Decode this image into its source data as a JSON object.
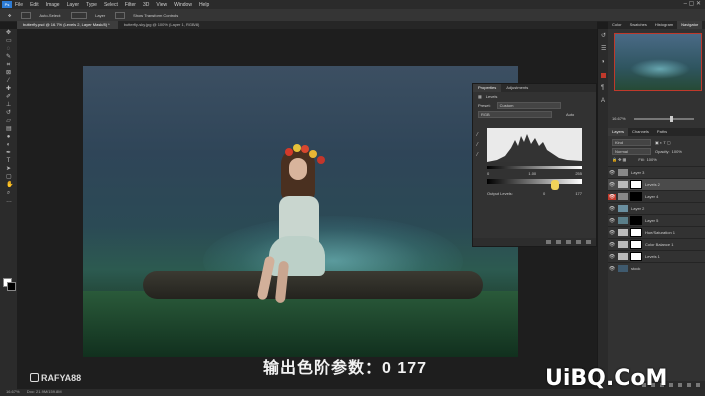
{
  "menubar": {
    "logo": "Ps",
    "items": [
      "File",
      "Edit",
      "Image",
      "Layer",
      "Type",
      "Select",
      "Filter",
      "3D",
      "View",
      "Window",
      "Help"
    ]
  },
  "options": {
    "auto_select": "Auto-Select:",
    "layer": "Layer",
    "show_transform": "Show Transform Controls"
  },
  "tabs": [
    {
      "label": "butterfly.psd @ 16.7% (Levels 2, Layer Mask/8) *",
      "active": true
    },
    {
      "label": "butterfly-sky.jpg @ 100% (Layer 1, RGB/8)",
      "active": false
    }
  ],
  "properties": {
    "tab1": "Properties",
    "tab2": "Adjustments",
    "levels_label": "Levels",
    "preset_label": "Preset:",
    "preset_value": "Custom",
    "channel_value": "RGB",
    "auto_label": "Auto",
    "input_low": "0",
    "input_mid": "1.00",
    "input_high": "255",
    "output_label": "Output Levels:",
    "output_low": "0",
    "output_high": "177"
  },
  "subtitle": "输出色阶参数：0 177",
  "watermark_left": "RAFYA88",
  "watermark_right": "UiBQ.CoM",
  "status": {
    "zoom": "16.67%",
    "doc": "Doc: 21.9M/159.8M"
  },
  "right_panel": {
    "tabs": [
      "Color",
      "Swatches",
      "Histogram",
      "Navigator"
    ],
    "active_tab": "Navigator",
    "zoom": "16.67%"
  },
  "layers_panel": {
    "tabs": [
      "Layers",
      "Channels",
      "Paths"
    ],
    "kind": "Kind",
    "blend_mode": "Normal",
    "opacity_label": "Opacity:",
    "opacity_value": "100%",
    "fill_label": "Fill:",
    "fill_value": "100%",
    "layers": [
      {
        "name": "Layer 3",
        "mask": false,
        "selected": false,
        "eye_red": false
      },
      {
        "name": "Levels 2",
        "mask": true,
        "selected": true,
        "eye_red": false
      },
      {
        "name": "Layer 4",
        "mask": true,
        "selected": false,
        "eye_red": true
      },
      {
        "name": "Layer 2",
        "mask": false,
        "selected": false,
        "eye_red": false
      },
      {
        "name": "Layer 5",
        "mask": true,
        "selected": false,
        "eye_red": false
      },
      {
        "name": "Hue/Saturation 1",
        "mask": true,
        "selected": false,
        "eye_red": false
      },
      {
        "name": "Color Balance 1",
        "mask": true,
        "selected": false,
        "eye_red": false
      },
      {
        "name": "Levels 1",
        "mask": true,
        "selected": false,
        "eye_red": false
      },
      {
        "name": "stock",
        "mask": false,
        "selected": false,
        "eye_red": false
      }
    ]
  }
}
